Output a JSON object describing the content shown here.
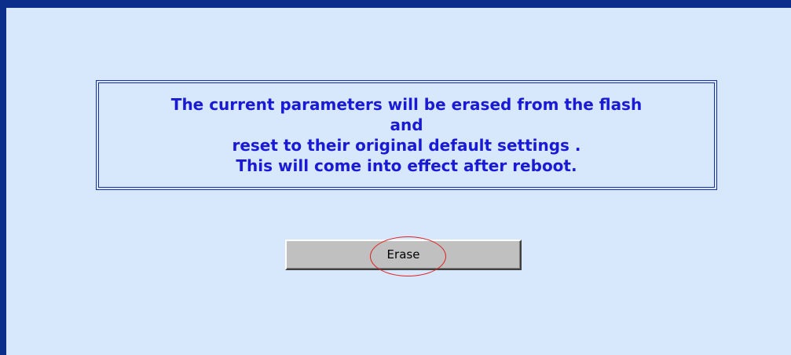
{
  "message": {
    "lines": [
      "The current parameters will be erased from the flash",
      "and",
      "reset to their original default settings .",
      "This will come into effect after reboot."
    ]
  },
  "erase_button": {
    "label": "Erase"
  },
  "colors": {
    "frame": "#0a2e8a",
    "background": "#d7e8fd",
    "message_text": "#1a1ad6",
    "highlight": "#e01f1f"
  }
}
